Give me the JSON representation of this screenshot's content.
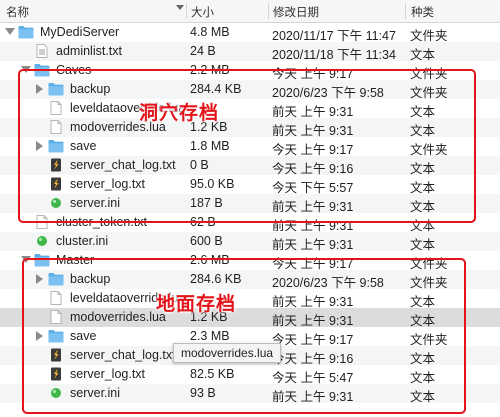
{
  "columns": {
    "name": "名称",
    "size": "大小",
    "date": "修改日期",
    "kind": "种类"
  },
  "rows": [
    {
      "name": "MyDediServer",
      "size": "4.8 MB",
      "date": "2020/11/17 下午 11:47",
      "kind": "文件夹",
      "icon": "folder-icon",
      "disclosure": "open",
      "depth": 0
    },
    {
      "name": "adminlist.txt",
      "size": "24 B",
      "date": "2020/11/18 下午 11:34",
      "kind": "文本",
      "icon": "text-file-icon",
      "disclosure": "none",
      "depth": 1
    },
    {
      "name": "Caves",
      "size": "2.2 MB",
      "date": "今天 上午 9:17",
      "kind": "文件夹",
      "icon": "folder-icon",
      "disclosure": "open",
      "depth": 1
    },
    {
      "name": "backup",
      "size": "284.4 KB",
      "date": "2020/6/23 下午 9:58",
      "kind": "文件夹",
      "icon": "folder-icon",
      "disclosure": "closed",
      "depth": 2
    },
    {
      "name": "leveldataoverride.lua",
      "size": "",
      "date": "前天 上午 9:31",
      "kind": "文本",
      "icon": "blank-file-icon",
      "disclosure": "none",
      "depth": 2
    },
    {
      "name": "modoverrides.lua",
      "size": "1.2 KB",
      "date": "前天 上午 9:31",
      "kind": "文本",
      "icon": "blank-file-icon",
      "disclosure": "none",
      "depth": 2
    },
    {
      "name": "save",
      "size": "1.8 MB",
      "date": "今天 上午 9:17",
      "kind": "文件夹",
      "icon": "folder-icon",
      "disclosure": "closed",
      "depth": 2
    },
    {
      "name": "server_chat_log.txt",
      "size": "0 B",
      "date": "今天 上午 9:16",
      "kind": "文本",
      "icon": "log-file-icon",
      "disclosure": "none",
      "depth": 2
    },
    {
      "name": "server_log.txt",
      "size": "95.0 KB",
      "date": "今天 下午 5:57",
      "kind": "文本",
      "icon": "log-file-icon",
      "disclosure": "none",
      "depth": 2
    },
    {
      "name": "server.ini",
      "size": "187 B",
      "date": "前天 上午 9:31",
      "kind": "文本",
      "icon": "ini-file-icon",
      "disclosure": "none",
      "depth": 2
    },
    {
      "name": "cluster_token.txt",
      "size": "62 B",
      "date": "前天 上午 9:31",
      "kind": "文本",
      "icon": "blank-file-icon",
      "disclosure": "none",
      "depth": 1
    },
    {
      "name": "cluster.ini",
      "size": "600 B",
      "date": "前天 上午 9:31",
      "kind": "文本",
      "icon": "ini-file-icon",
      "disclosure": "none",
      "depth": 1
    },
    {
      "name": "Master",
      "size": "2.6 MB",
      "date": "今天 上午 9:17",
      "kind": "文件夹",
      "icon": "folder-icon",
      "disclosure": "open",
      "depth": 1
    },
    {
      "name": "backup",
      "size": "284.6 KB",
      "date": "2020/6/23 下午 9:58",
      "kind": "文件夹",
      "icon": "folder-icon",
      "disclosure": "closed",
      "depth": 2
    },
    {
      "name": "leveldataoverride.lua",
      "size": "",
      "date": "前天 上午 9:31",
      "kind": "文本",
      "icon": "blank-file-icon",
      "disclosure": "none",
      "depth": 2
    },
    {
      "name": "modoverrides.lua",
      "size": "1.2 KB",
      "date": "前天 上午 9:31",
      "kind": "文本",
      "icon": "blank-file-icon",
      "disclosure": "none",
      "depth": 2
    },
    {
      "name": "save",
      "size": "2.3 MB",
      "date": "今天 上午 9:17",
      "kind": "文件夹",
      "icon": "folder-icon",
      "disclosure": "closed",
      "depth": 2
    },
    {
      "name": "server_chat_log.txt",
      "size": "0 B",
      "date": "今天 上午 9:16",
      "kind": "文本",
      "icon": "log-file-icon",
      "disclosure": "none",
      "depth": 2
    },
    {
      "name": "server_log.txt",
      "size": "82.5 KB",
      "date": "今天 上午 5:47",
      "kind": "文本",
      "icon": "log-file-icon",
      "disclosure": "none",
      "depth": 2
    },
    {
      "name": "server.ini",
      "size": "93 B",
      "date": "前天 上午 9:31",
      "kind": "文本",
      "icon": "ini-file-icon",
      "disclosure": "none",
      "depth": 2
    }
  ],
  "annotations": {
    "caves_label": "洞穴存档",
    "master_label": "地面存档"
  },
  "tooltip": "modoverrides.lua",
  "colors": {
    "folder": "#5eaee8",
    "highlight_box": "#e3141a",
    "selected_row": "#dcdcdc"
  }
}
